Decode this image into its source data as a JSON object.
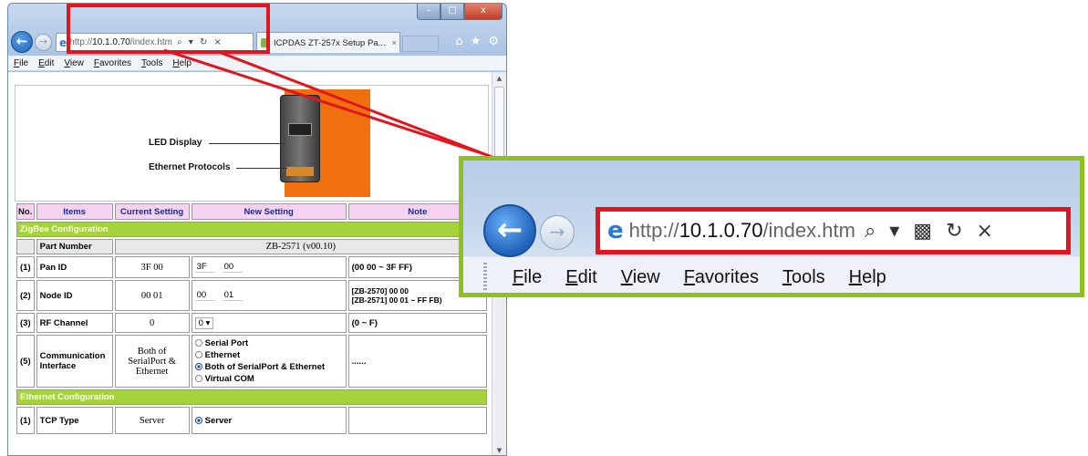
{
  "browser": {
    "url_prefix": "http://",
    "url_host": "10.1.0.70",
    "url_path": "/index.htm",
    "address_tools": "⌕ ▾ ↻ ×",
    "tab_title": "ICPDAS ZT-257x Setup Pa...",
    "tab_close": "×",
    "window_min": "–",
    "window_max": "□",
    "window_close": "x",
    "right_icons": [
      "⌂",
      "★",
      "⚙"
    ],
    "back_glyph": "←",
    "forward_glyph": "→",
    "menu": [
      "File",
      "Edit",
      "View",
      "Favorites",
      "Tools",
      "Help"
    ]
  },
  "zoom": {
    "url_prefix": "http://",
    "url_host": "10.1.0.70",
    "url_path": "/index.htm",
    "address_tools": "⌕ ▾ ▩ ↻ ×",
    "menu": [
      "File",
      "Edit",
      "View",
      "Favorites",
      "Tools",
      "Help"
    ]
  },
  "diagram": {
    "led_label": "LED Display",
    "ethernet_label": "Ethernet Protocols"
  },
  "table": {
    "headers": [
      "No.",
      "Items",
      "Current Setting",
      "New Setting",
      "Note"
    ],
    "zigbee_section": "ZigBee Configuration",
    "part_number_label": "Part Number",
    "part_number_value": "ZB-2571 (v00.10)",
    "rows": [
      {
        "no": "(1)",
        "item": "Pan ID",
        "current": "3F 00",
        "new_a": "3F",
        "new_b": "00",
        "note": "(00 00 ~ 3F FF)"
      },
      {
        "no": "(2)",
        "item": "Node ID",
        "current": "00 01",
        "new_a": "00",
        "new_b": "01",
        "note_l1": "[ZB-2570] 00 00",
        "note_l2": "[ZB-2571] 00 01 ~ FF FB)"
      },
      {
        "no": "(3)",
        "item": "RF Channel",
        "current": "0",
        "new_sel": "0 ▾",
        "note": "(0 ~ F)"
      }
    ],
    "comm": {
      "no": "(5)",
      "item_l1": "Communication",
      "item_l2": "Interface",
      "current_l1": "Both of",
      "current_l2": "SerialPort &",
      "current_l3": "Ethernet",
      "options": [
        "Serial Port",
        "Ethernet",
        "Both of SerialPort & Ethernet",
        "Virtual COM"
      ],
      "selected": 2,
      "note": "......"
    },
    "ethernet_section": "Ethernet Configuration",
    "tcp": {
      "no": "(1)",
      "item": "TCP Type",
      "current": "Server",
      "option": "Server"
    }
  },
  "colors": {
    "highlight": "#e0161e",
    "zoom_border": "#8dc11f",
    "section_bar": "#a6d33a",
    "header_bg": "#f7d2f3"
  }
}
